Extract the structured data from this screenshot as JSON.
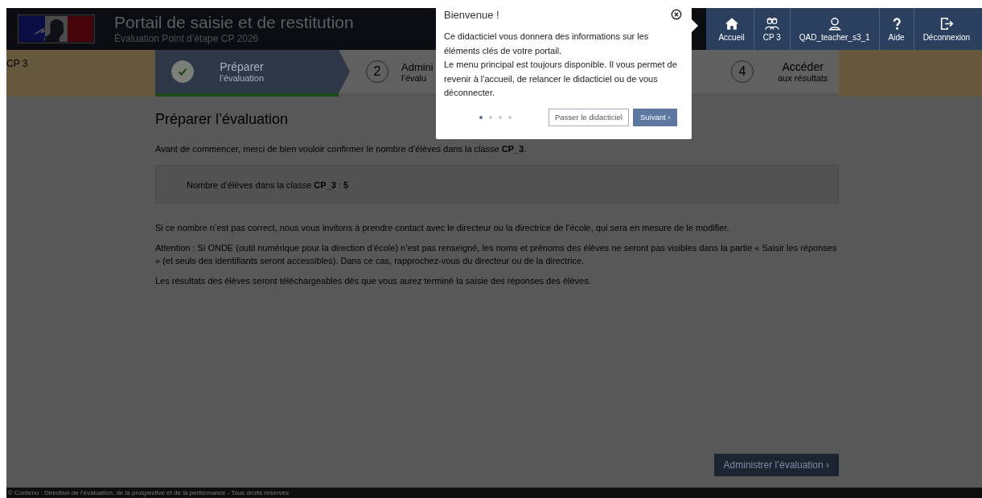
{
  "header": {
    "title": "Portail de saisie et de restitution",
    "subtitle": "Évaluation Point d’étape CP 2026"
  },
  "nav": [
    {
      "label": "Accueil"
    },
    {
      "label": "CP 3"
    },
    {
      "label": "QAD_teacher_s3_1"
    },
    {
      "label": "Aide"
    },
    {
      "label": "Déconnexion"
    }
  ],
  "class_label": "CP 3",
  "steps": [
    {
      "done": true,
      "selected": true,
      "title": "Préparer",
      "subtitle": "l’évaluation"
    },
    {
      "number": "2",
      "done": false,
      "selected": false,
      "title": "Admini",
      "subtitle": "l’évalu"
    },
    {
      "number": "4",
      "done": false,
      "selected": false,
      "title": "Accéder",
      "subtitle": "aux résultats"
    }
  ],
  "page": {
    "title": "Préparer l’évaluation",
    "intro": "Avant de commencer, merci de bien vouloir confirmer le nombre d’élèves dans la classe **CP_3**.",
    "count_line": "Nombre d’élèves dans la classe **CP_3** : **5**",
    "paragraphs": [
      "Si ce nombre n’est pas correct, nous vous invitons à prendre contact avec le directeur ou la directrice de l’école, qui sera en mesure de le modifier.",
      "Attention : Si ONDE (outil numérique pour la direction d’école) n’est pas renseigné, les noms et prénoms des élèves ne seront pas visibles dans la partie « Saisir les réponses » (et seuls des identifiants seront accessibles). Dans ce cas, rapprochez-vous du directeur ou de la directrice.",
      "Les résultats des élèves seront téléchargeables dès que vous aurez terminé la saisie des réponses des élèves."
    ],
    "next_button": "Administrer l’évaluation",
    "next_arrow": "›"
  },
  "footer": "© Contenu : Direction de l’évaluation, de la prospective et de la performance - Tous droits réservés",
  "tutorial": {
    "title": "Bienvenue !",
    "text": [
      "Ce didacticiel vous donnera des informations sur les éléments clés de votre portail.",
      "Le menu principal est toujours disponible. Il vous permet de revenir à l'accueil, de relancer le didacticiel ou de vous déconnecter."
    ],
    "dots": [
      {
        "selected": true
      },
      {
        "selected": false
      },
      {
        "selected": false
      },
      {
        "selected": false
      }
    ],
    "skip_button": "Passer le didacticiel",
    "next_button": "Suivant",
    "next_arrow": "›"
  }
}
